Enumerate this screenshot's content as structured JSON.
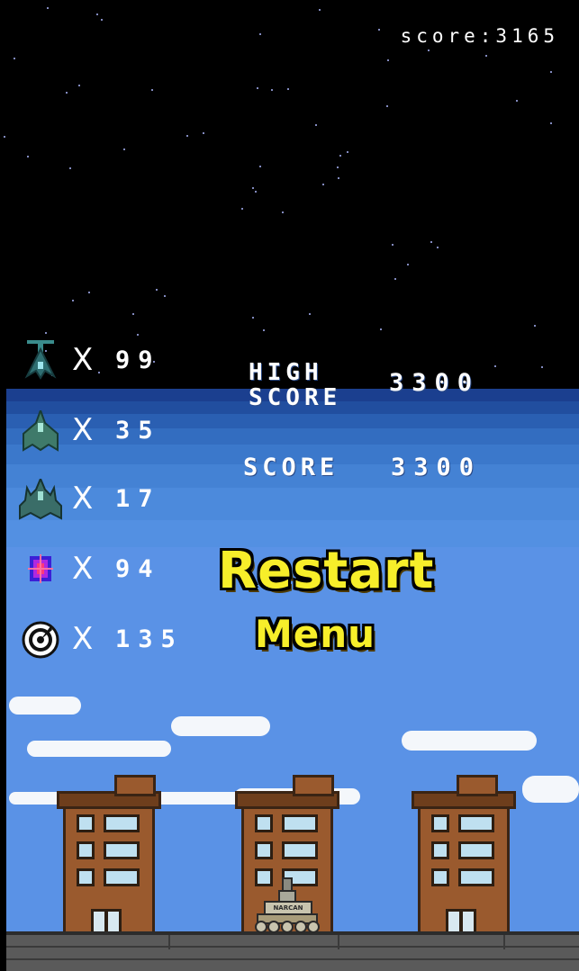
{
  "hud": {
    "score_text": "score:3165"
  },
  "kill_stats": [
    {
      "icon": "enemy-fighter-small-icon",
      "x": "X",
      "count": "99"
    },
    {
      "icon": "enemy-fighter-medium-icon",
      "x": "X",
      "count": "35"
    },
    {
      "icon": "enemy-fighter-large-icon",
      "x": "X",
      "count": "17"
    },
    {
      "icon": "powerup-crystal-icon",
      "x": "X",
      "count": "94"
    },
    {
      "icon": "stopwatch-icon",
      "x": "X",
      "count": "135"
    }
  ],
  "scores": {
    "high_score_label": "HIGH SCORE",
    "high_score_value": "3300",
    "score_label": "SCORE",
    "score_value": "3300"
  },
  "menu": {
    "restart_label": "Restart",
    "menu_label": "Menu"
  },
  "tank": {
    "label": "NARCAN"
  },
  "colors": {
    "button_text": "#f7ee2a",
    "sky_day": "#5a92e6",
    "building": "#9a5a2e"
  }
}
